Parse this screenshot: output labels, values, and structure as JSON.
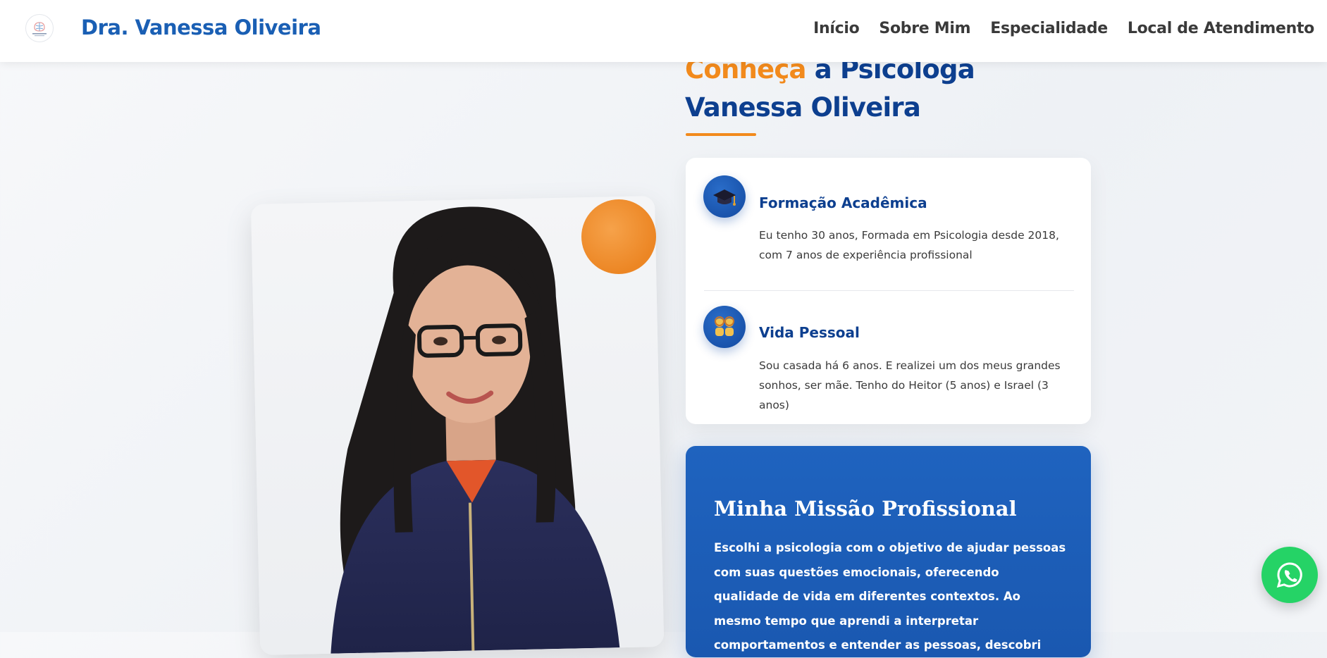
{
  "header": {
    "brand": "Dra. Vanessa Oliveira",
    "logo_icon": "brain-logo-icon",
    "nav": [
      "Início",
      "Sobre Mim",
      "Especialidade",
      "Local de Atendimento"
    ]
  },
  "about": {
    "heading_accent": "Conheça",
    "heading_rest": " a Psicologa Vanessa Oliveira",
    "items": [
      {
        "icon": "graduation-cap-icon",
        "title": "Formação Acadêmica",
        "text": "Eu tenho 30 anos, Formada em Psicologia desde 2018, com 7 anos de experiência profissional"
      },
      {
        "icon": "family-icon",
        "title": "Vida Pessoal",
        "text": "Sou casada há 6 anos. E realizei um dos meus grandes sonhos, ser mãe. Tenho do Heitor (5 anos) e Israel (3 anos)"
      }
    ],
    "mission": {
      "title": "Minha Missão Profissional",
      "text": "Escolhi a psicologia com o objetivo de ajudar pessoas com suas questões emocionais, oferecendo qualidade de vida em diferentes contextos. Ao mesmo tempo que aprendi a interpretar comportamentos e entender as pessoas, descobri"
    }
  },
  "whatsapp_icon": "whatsapp-icon",
  "colors": {
    "brand_blue": "#1a5fb4",
    "navy": "#0d3f8f",
    "accent_orange": "#f28a1c",
    "whatsapp_green": "#25d366"
  }
}
